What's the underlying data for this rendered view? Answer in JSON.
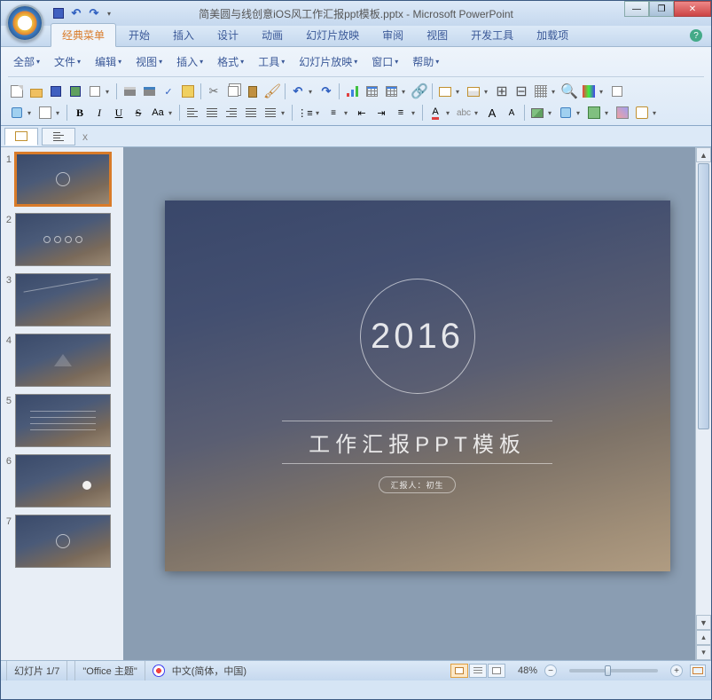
{
  "titlebar": {
    "filename": "简美圆与线创意iOS风工作汇报ppt模板.pptx",
    "app": "Microsoft PowerPoint",
    "sep": " - "
  },
  "ribbon_tabs": {
    "t0": "经典菜单",
    "t1": "开始",
    "t2": "插入",
    "t3": "设计",
    "t4": "动画",
    "t5": "幻灯片放映",
    "t6": "审阅",
    "t7": "视图",
    "t8": "开发工具",
    "t9": "加载项"
  },
  "menu_row": {
    "m0": "全部",
    "m1": "文件",
    "m2": "编辑",
    "m3": "视图",
    "m4": "插入",
    "m5": "格式",
    "m6": "工具",
    "m7": "幻灯片放映",
    "m8": "窗口",
    "m9": "帮助"
  },
  "format_row": {
    "b": "B",
    "i": "I",
    "u": "U",
    "s": "S",
    "aa": "Aa",
    "fcolor": "A",
    "abc": "abc",
    "a_up": "A",
    "a_dn": "A"
  },
  "panel_tabs": {
    "close": "x"
  },
  "slide": {
    "year": "2016",
    "title": "工作汇报PPT模板",
    "badge": "汇报人：初生"
  },
  "thumbs": {
    "n1": "1",
    "n2": "2",
    "n3": "3",
    "n4": "4",
    "n5": "5",
    "n6": "6",
    "n7": "7"
  },
  "status": {
    "slide_pos": "幻灯片 1/7",
    "theme": "\"Office 主题\"",
    "lang": "中文(简体，中国)",
    "zoom": "48%",
    "minus": "−",
    "plus": "+"
  },
  "win": {
    "min": "—",
    "max": "❐",
    "close": "✕"
  },
  "qat": {
    "undo": "↶",
    "redo": "↷"
  },
  "vscroll": {
    "up": "▲",
    "dn": "▼",
    "pu": "▴",
    "pd": "▾"
  }
}
